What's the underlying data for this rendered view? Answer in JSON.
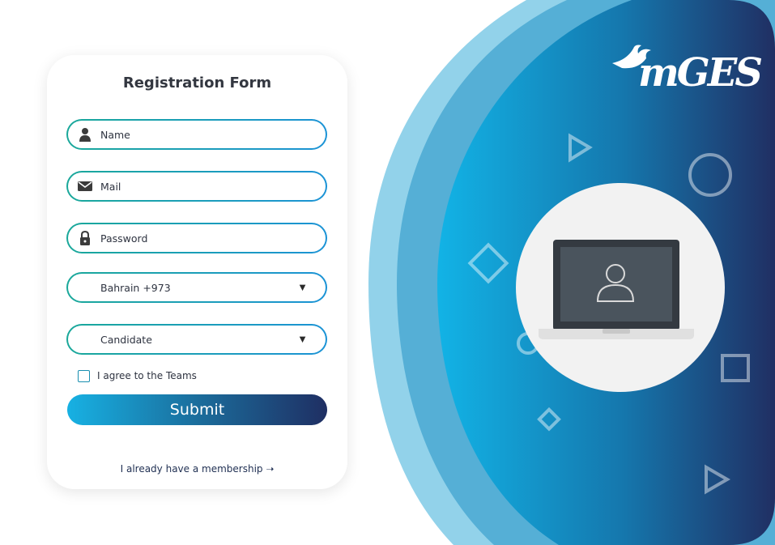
{
  "form": {
    "title": "Registration Form",
    "name_placeholder": "Name",
    "mail_placeholder": "Mail",
    "password_placeholder": "Password",
    "country_value": "Bahrain +973",
    "role_value": "Candidate",
    "agree_label": "I agree to the Teams",
    "submit_label": "Submit",
    "membership_link": "I already have a membership ➝"
  },
  "brand": {
    "logo_text": "mGES"
  },
  "icons": [
    "user-icon",
    "mail-icon",
    "lock-icon",
    "caret-down-icon",
    "laptop-user-icon"
  ],
  "colors": {
    "accent_teal": "#1aa89a",
    "accent_blue": "#1b93d6",
    "navy": "#1f2f63",
    "panel_light": "#8ecfe8"
  }
}
